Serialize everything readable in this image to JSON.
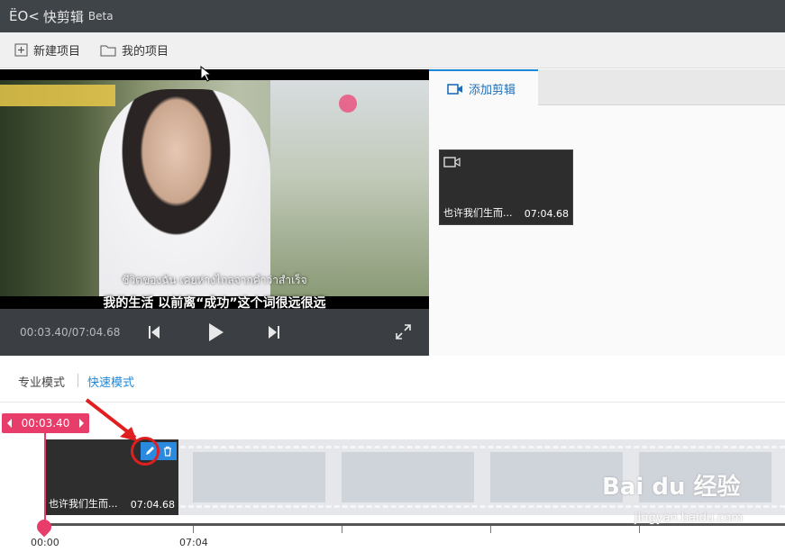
{
  "app": {
    "logo_mark": "ЁO<",
    "name": "快剪辑",
    "badge": "Beta"
  },
  "toolbar": {
    "new_project": "新建项目",
    "my_projects": "我的项目"
  },
  "player": {
    "subtitle_thai": "ชีวิตของฉัน เคยห่างไกลจากคำว่าสำเร็จ",
    "subtitle_cn": "我的生活  以前离“成功”这个词很远很远",
    "time": "00:03.40/07:04.68"
  },
  "library": {
    "tab_label": "添加剪辑",
    "clip": {
      "name": "也许我们生而...",
      "duration": "07:04.68"
    }
  },
  "modes": {
    "pro": "专业模式",
    "fast": "快速模式",
    "active": "fast"
  },
  "timeline": {
    "playhead_time": "00:03.40",
    "clip": {
      "name": "也许我们生而...",
      "duration": "07:04.68"
    },
    "ruler_labels": [
      "00:00",
      "07:04"
    ]
  },
  "watermark": {
    "main": "Bai du 经验",
    "sub": "jingyan.baidu.com"
  },
  "colors": {
    "accent": "#1e88d8",
    "playhead": "#e83d6a",
    "annotation": "#e02020"
  }
}
